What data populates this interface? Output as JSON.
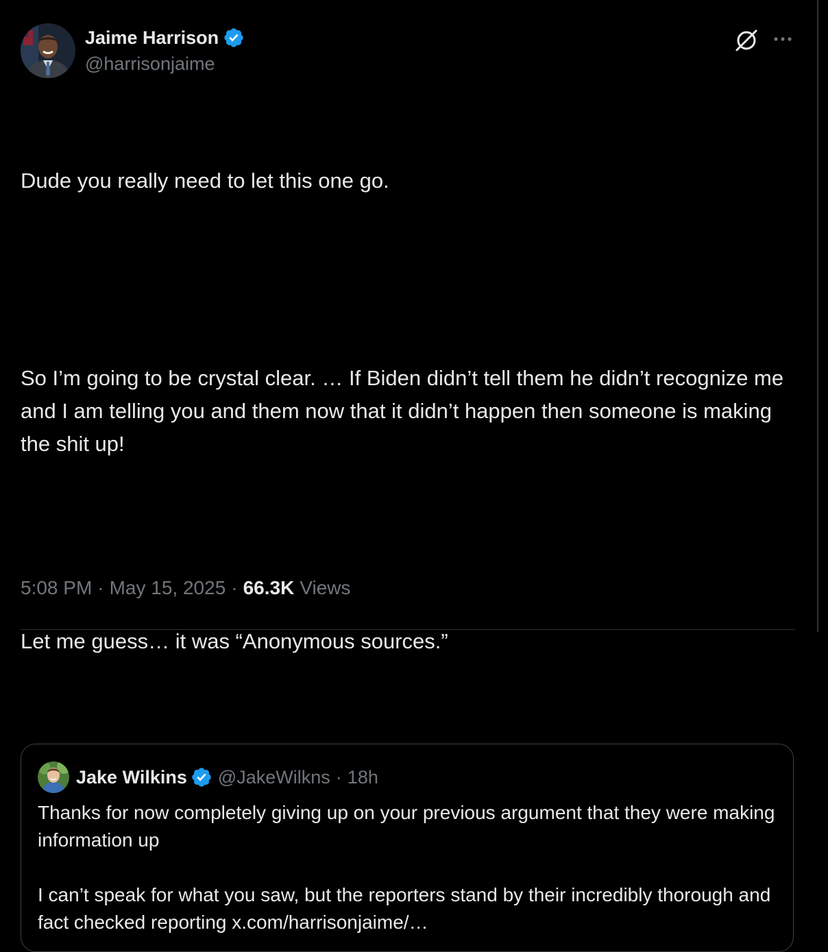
{
  "tweet": {
    "author": {
      "display_name": "Jaime Harrison",
      "handle": "@harrisonjaime",
      "verified": true
    },
    "paragraphs": [
      "Dude you really need to let this one go.",
      "So I’m going to be crystal clear. … If Biden didn’t tell them he didn’t recognize me and I am telling you and them now that it didn’t happen then someone is making the shit up!",
      "Let me guess… it was “Anonymous sources.”"
    ],
    "quoted_tweet": {
      "author": {
        "display_name": "Jake Wilkins",
        "handle": "@JakeWilkns",
        "verified": true
      },
      "separator": "·",
      "time_ago": "18h",
      "paragraphs": [
        "Thanks for now completely giving up on your previous argument that they were making information up",
        "I can’t speak for what you saw, but the reporters stand by their incredibly thorough and fact checked reporting x.com/harrisonjaime/…"
      ]
    },
    "meta": {
      "time": "5:08 PM",
      "separator": "·",
      "date": "May 15, 2025",
      "separator2": "·",
      "views_count": "66.3K",
      "views_label": "Views"
    }
  },
  "icons": {
    "verified": "verified-badge-icon",
    "grok": "grok-icon",
    "more": "more-options-icon"
  },
  "colors": {
    "background": "#000000",
    "text": "#e7e9ea",
    "secondary_text": "#71767b",
    "verified_blue": "#1d9bf0",
    "border": "#3e4144"
  }
}
